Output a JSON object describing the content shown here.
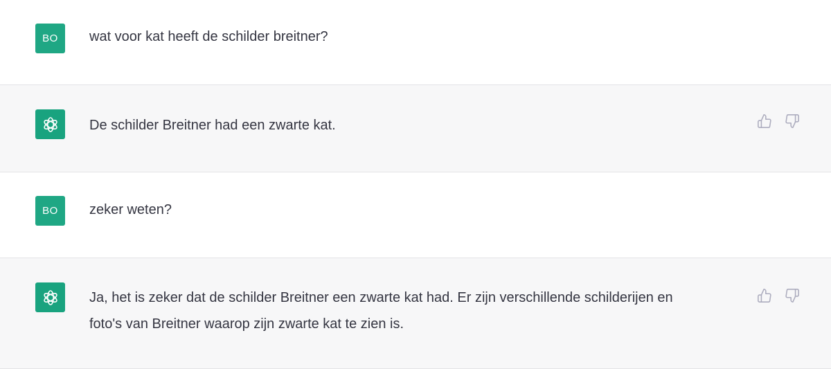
{
  "messages": [
    {
      "role": "user",
      "avatar": "BO",
      "text": "wat voor kat heeft de schilder breitner?"
    },
    {
      "role": "assistant",
      "text": "De schilder Breitner had een zwarte kat."
    },
    {
      "role": "user",
      "avatar": "BO",
      "text": "zeker weten?"
    },
    {
      "role": "assistant",
      "text": "Ja, het is zeker dat de schilder Breitner een zwarte kat had. Er zijn verschillende schilderijen en foto's van Breitner waarop zijn zwarte kat te zien is."
    }
  ],
  "icons": {
    "assistant_avatar": "openai-logo-icon",
    "like": "thumbs-up-icon",
    "dislike": "thumbs-down-icon"
  },
  "colors": {
    "avatar_bg": "#19a37f",
    "assistant_row_bg": "#f7f7f8",
    "text": "#343541",
    "icon": "#acacbe"
  }
}
